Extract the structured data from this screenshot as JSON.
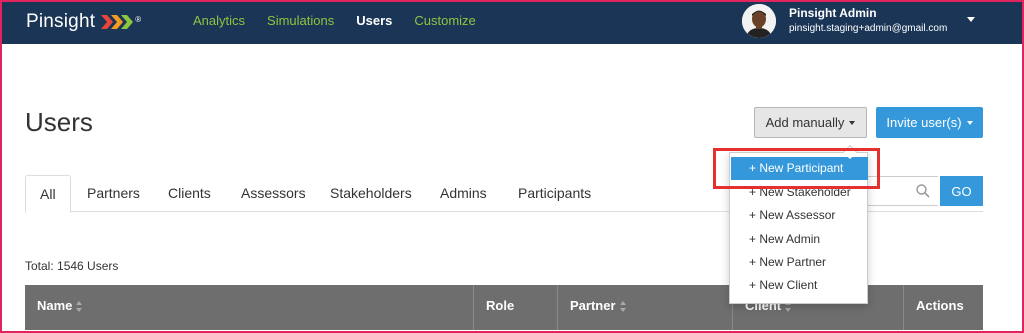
{
  "brand": {
    "name": "Pinsight",
    "registered": "®"
  },
  "nav": [
    {
      "label": "Analytics",
      "active": false
    },
    {
      "label": "Simulations",
      "active": false
    },
    {
      "label": "Users",
      "active": true
    },
    {
      "label": "Customize",
      "active": false
    }
  ],
  "user": {
    "name": "Pinsight Admin",
    "email": "pinsight.staging+admin@gmail.com"
  },
  "page": {
    "title": "Users"
  },
  "actions": {
    "add_manually": "Add manually",
    "invite": "Invite user(s)"
  },
  "tabs": [
    "All",
    "Partners",
    "Clients",
    "Assessors",
    "Stakeholders",
    "Admins",
    "Participants"
  ],
  "search": {
    "placeholder": "",
    "go_label": "GO"
  },
  "total": "Total: 1546 Users",
  "table": {
    "headers": [
      "Name",
      "Role",
      "Partner",
      "Client",
      "Actions"
    ]
  },
  "dropdown": {
    "items": [
      "+ New Participant",
      "+ New Stakeholder",
      "+ New Assessor",
      "+ New Admin",
      "+ New Partner",
      "+ New Client"
    ],
    "selected_index": 0
  },
  "colors": {
    "topbar": "#1b3556",
    "nav_link": "#8cc63f",
    "primary": "#3498db",
    "table_header": "#6e6e6e",
    "highlight": "#e53030"
  }
}
